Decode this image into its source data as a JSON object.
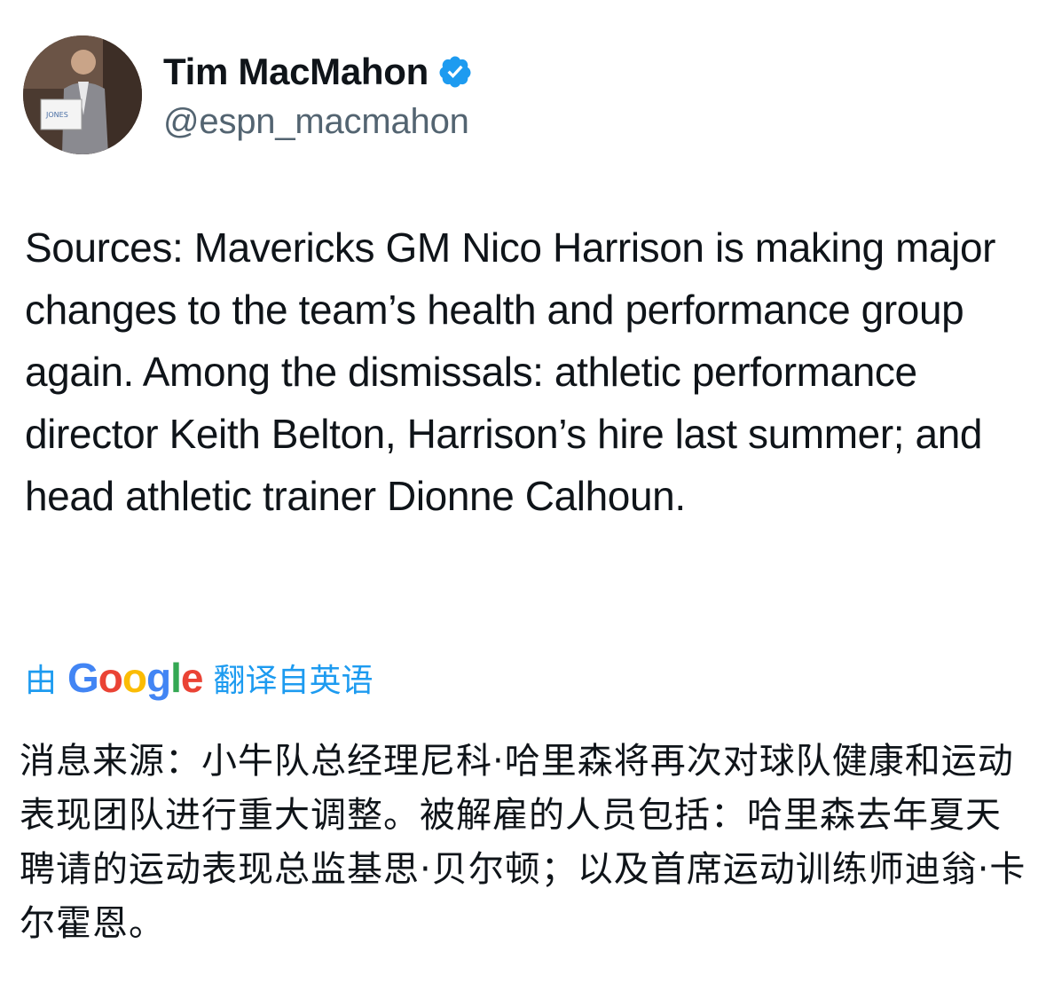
{
  "author": {
    "display_name": "Tim MacMahon",
    "handle": "@espn_macmahon",
    "verified": true,
    "avatar": "avatar-photo",
    "verified_color": "#1d9bf0"
  },
  "tweet": {
    "text": "Sources: Mavericks GM Nico Harrison is making major changes to the team’s health and performance group again. Among the dismissals: athletic performance director Keith Belton, Harrison’s hire last summer; and head athletic trainer Dionne Calhoun."
  },
  "translation": {
    "prefix": "由",
    "provider_letters": [
      "G",
      "o",
      "o",
      "g",
      "l",
      "e"
    ],
    "provider_colors": [
      "#4285f4",
      "#ea4335",
      "#fbbc05",
      "#4285f4",
      "#34a853",
      "#ea4335"
    ],
    "suffix": "翻译自英语",
    "text": "消息来源：小牛队总经理尼科·哈里森将再次对球队健康和运动表现团队进行重大调整。被解雇的人员包括：哈里森去年夏天聘请的运动表现总监基思·贝尔顿；以及首席运动训练师迪翁·卡尔霍恩。"
  }
}
